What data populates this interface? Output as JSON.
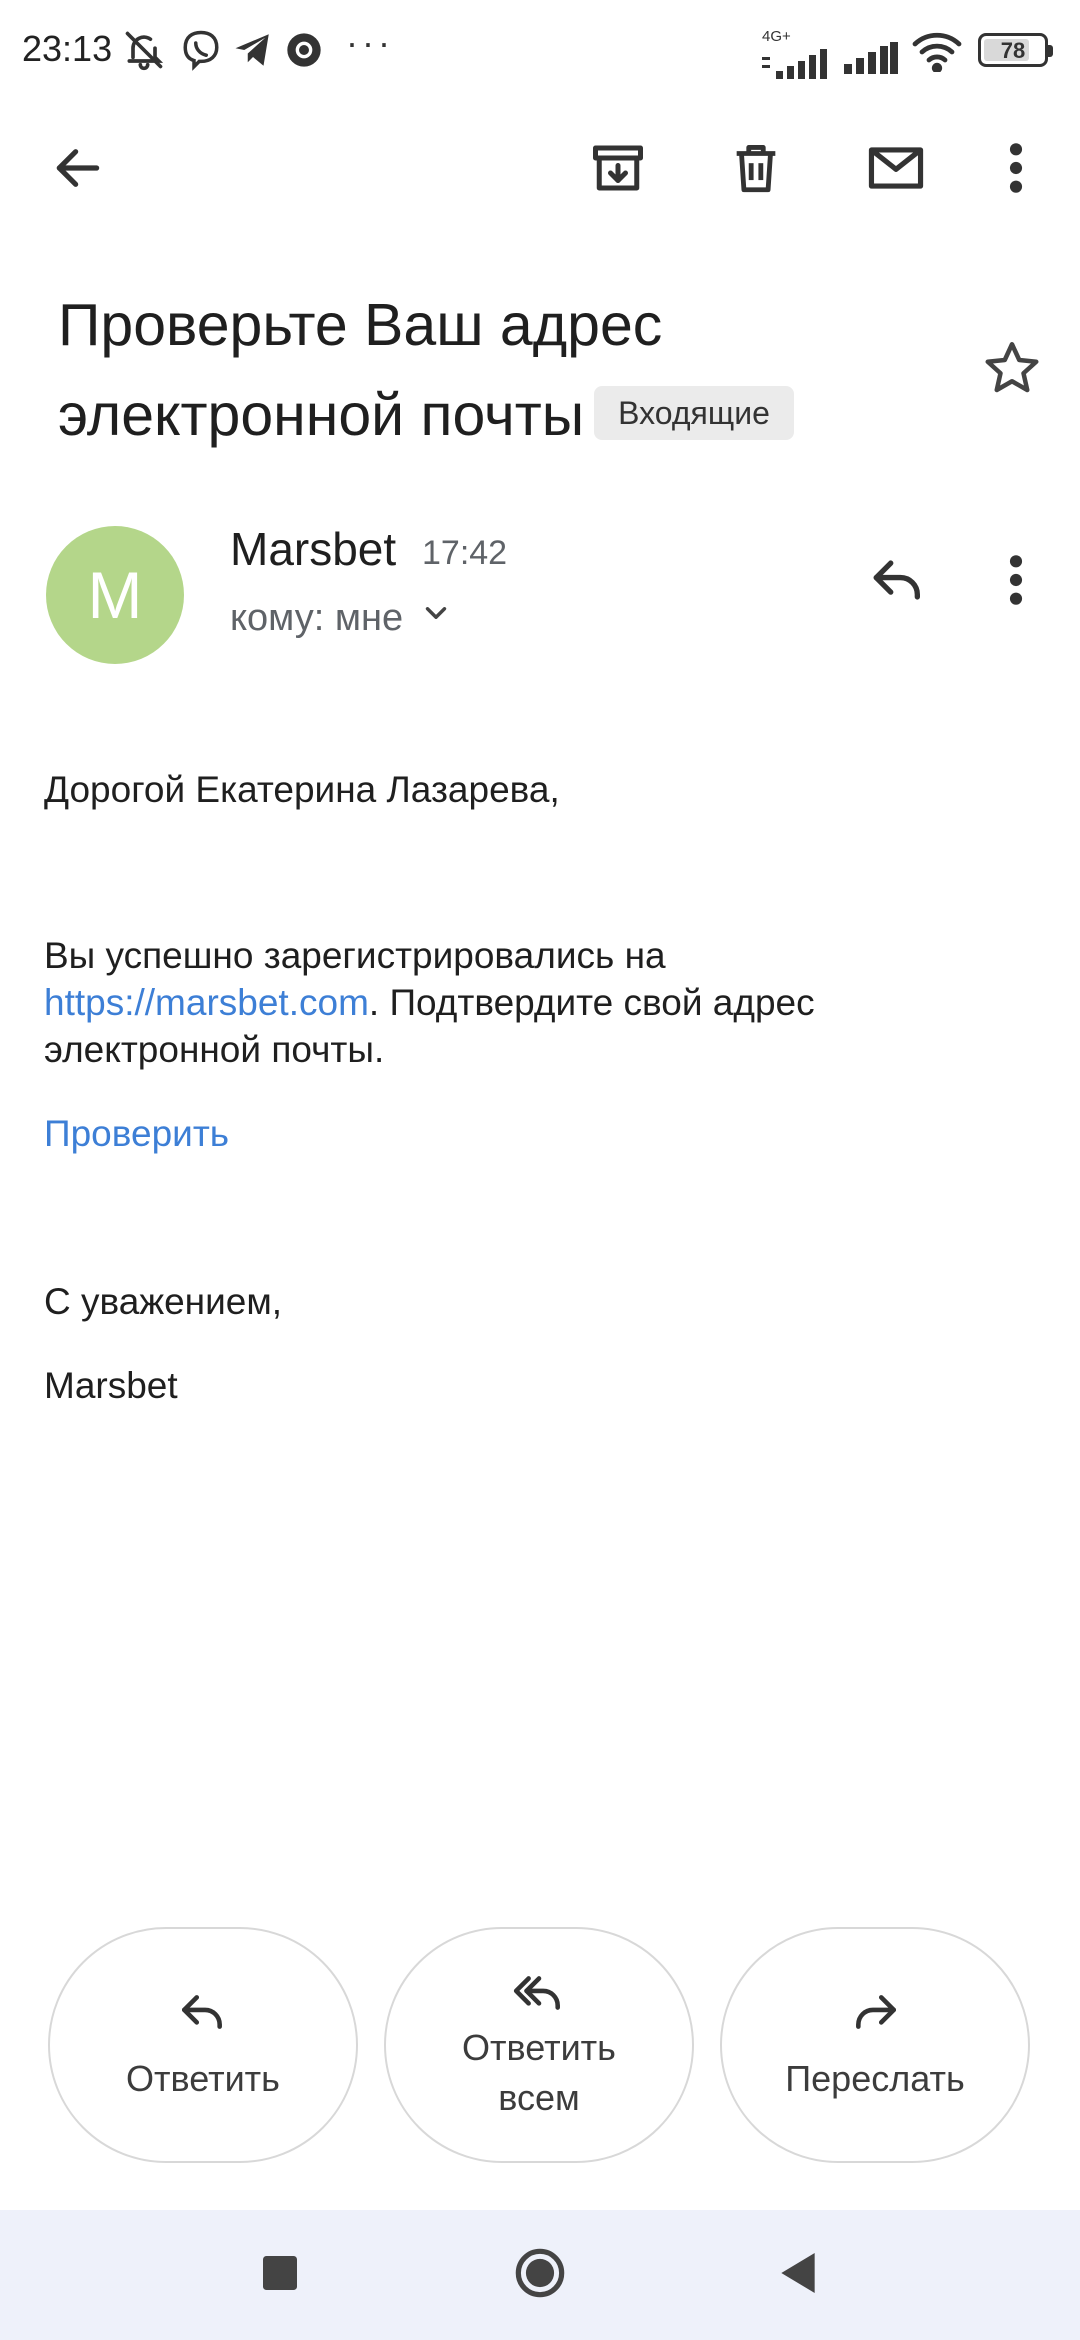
{
  "status_bar": {
    "time": "23:13",
    "network_type": "4G+",
    "battery": "78",
    "battery_level": 0.78,
    "icons": [
      "mute-icon",
      "viber-icon",
      "telegram-icon",
      "chrome-icon",
      "more-notifications-icon",
      "signal-icon",
      "signal-icon",
      "wifi-icon",
      "battery-icon"
    ]
  },
  "toolbar": {
    "icons": [
      "back-arrow-icon",
      "archive-icon",
      "trash-icon",
      "mail-icon",
      "more-vert-icon"
    ]
  },
  "email": {
    "subject": "Проверьте Ваш адрес электронной почты",
    "label": "Входящие",
    "sender": {
      "initial": "M",
      "name": "Marsbet",
      "time": "17:42",
      "recipient": "кому: мне"
    },
    "body": {
      "greeting": "Дорогой Екатерина Лазарева,",
      "line1": "Вы успешно зарегистрировались на",
      "link": "https://marsbet.com",
      "line2": ". Подтвердите свой адрес",
      "line3": "электронной почты.",
      "verify_link": "Проверить",
      "closing": "С уважением,",
      "signature": "Marsbet"
    }
  },
  "actions": {
    "reply": "Ответить",
    "reply_all_line1": "Ответить",
    "reply_all_line2": "всем",
    "forward": "Переслать"
  },
  "colors": {
    "avatar": "#b4d68a",
    "link": "#3d7fd6",
    "nav_bar": "#eef1fa",
    "chip_bg": "#ebebeb"
  }
}
